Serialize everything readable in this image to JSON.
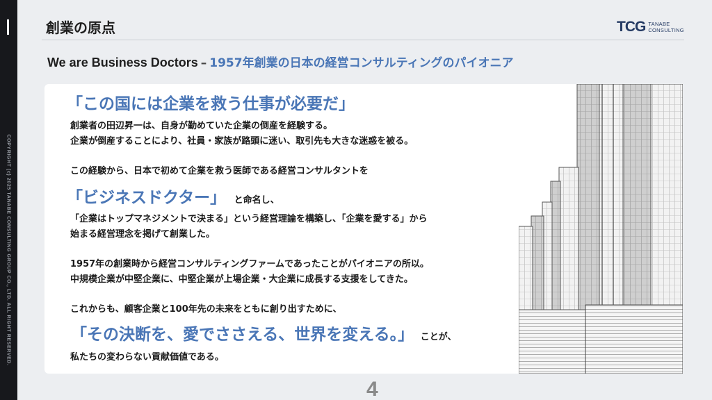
{
  "page_title": "創業の原点",
  "copyright": "COPYRIGHT (c) 2025 TANABE CONSULTING GROUP CO., LTD. ALL RIGHT RESERVED.",
  "logo": {
    "mark": "TCG",
    "line1": "TANABE",
    "line2": "CONSULTING"
  },
  "subtitle": {
    "en": "We are Business Doctors",
    "dash": "–",
    "jp": "1957年創業の日本の経営コンサルティングのパイオニア"
  },
  "content": {
    "headline": "「この国には企業を救う仕事が必要だ」",
    "p1_line1": "創業者の田辺昇一は、自身が勤めていた企業の倒産を経験する。",
    "p1_line2": "企業が倒産することにより、社員・家族が路頭に迷い、取引先も大きな迷惑を被る。",
    "p2_line1": "この経験から、日本で初めて企業を救う医師である経営コンサルタントを",
    "p2_big": "「ビジネスドクター」",
    "p2_suffix": "と命名し、",
    "p2_line3": "「企業はトップマネジメントで決まる」という経営理論を構築し、「企業を愛する」から",
    "p2_line4": "始まる経営理念を掲げて創業した。",
    "p3_line1": "1957年の創業時から経営コンサルティングファームであったことがパイオニアの所以。",
    "p3_line2": "中規模企業が中堅企業に、中堅企業が上場企業・大企業に成長する支援をしてきた。",
    "p4_line1": "これからも、顧客企業と100年先の未来をともに創り出すために、",
    "p4_big": "「その決断を、愛でささえる、世界を変える。」",
    "p4_suffix": "ことが、",
    "p4_line3": "私たちの変わらない貢献価値である。"
  },
  "page_number": "4",
  "colors": {
    "accent": "#4a76b6",
    "side_strip": "#17181c",
    "background": "#eceef1",
    "logo": "#243a63"
  }
}
